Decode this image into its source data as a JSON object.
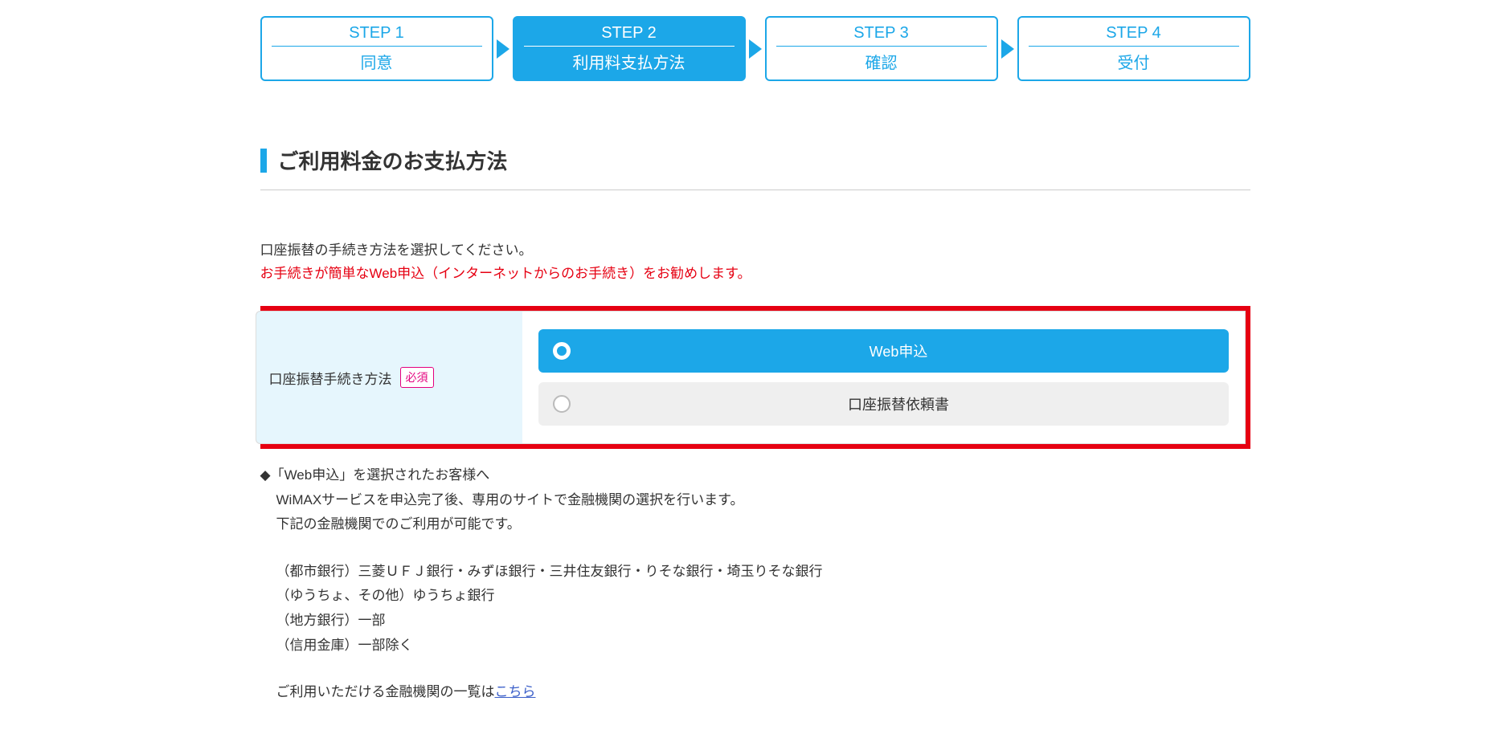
{
  "steps": [
    {
      "label": "STEP 1",
      "sub": "同意",
      "active": false
    },
    {
      "label": "STEP 2",
      "sub": "利用料支払方法",
      "active": true
    },
    {
      "label": "STEP 3",
      "sub": "確認",
      "active": false
    },
    {
      "label": "STEP 4",
      "sub": "受付",
      "active": false
    }
  ],
  "section_title": "ご利用料金のお支払方法",
  "instruction": "口座振替の手続き方法を選択してください。",
  "recommend": "お手続きが簡単なWeb申込（インターネットからのお手続き）をお勧めします。",
  "form": {
    "label": "口座振替手続き方法",
    "required": "必須",
    "options": [
      {
        "label": "Web申込",
        "selected": true
      },
      {
        "label": "口座振替依頼書",
        "selected": false
      }
    ]
  },
  "notes": {
    "heading": "◆「Web申込」を選択されたお客様へ",
    "line1": "WiMAXサービスを申込完了後、専用のサイトで金融機関の選択を行います。",
    "line2": "下記の金融機関でのご利用が可能です。",
    "bank1": "（都市銀行）三菱ＵＦＪ銀行・みずほ銀行・三井住友銀行・りそな銀行・埼玉りそな銀行",
    "bank2": "（ゆうちょ、その他）ゆうちょ銀行",
    "bank3": "（地方銀行）一部",
    "bank4": "（信用金庫）一部除く",
    "link_prefix": "ご利用いただける金融機関の一覧は",
    "link_text": "こちら"
  }
}
